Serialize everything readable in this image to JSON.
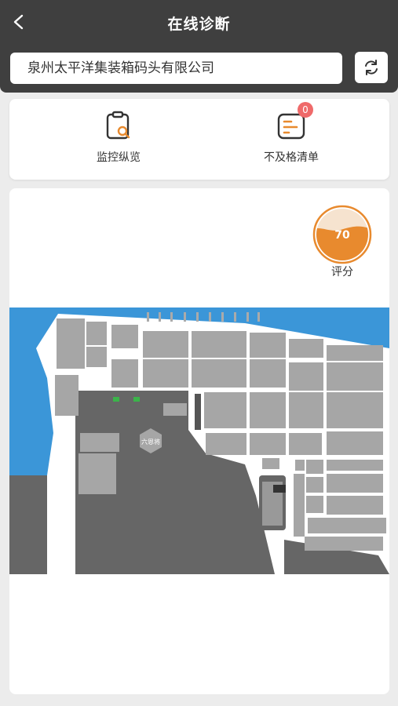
{
  "header": {
    "title": "在线诊断"
  },
  "company": {
    "name": "泉州太平洋集装箱码头有限公司"
  },
  "nav": {
    "monitor_label": "监控纵览",
    "failed_label": "不及格清单",
    "failed_count": "0"
  },
  "score": {
    "value": "70",
    "label": "评分",
    "fraction": 0.6
  },
  "map": {
    "hexagon_label": "六恩将"
  },
  "colors": {
    "accent": "#e88a2e",
    "header": "#3f3f3f",
    "sea": "#3b96d8",
    "badge": "#ef6a6a"
  }
}
